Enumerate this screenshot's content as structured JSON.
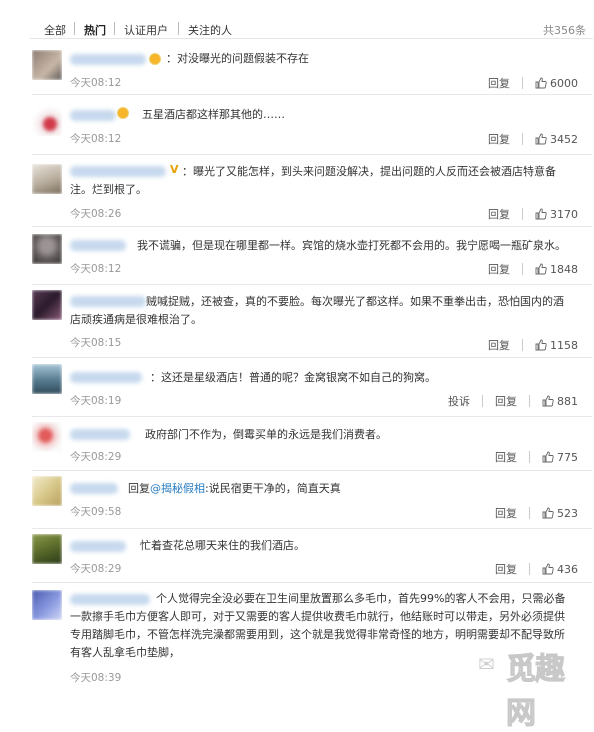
{
  "tabs": [
    {
      "label": "全部"
    },
    {
      "label": "热门"
    },
    {
      "label": "认证用户"
    },
    {
      "label": "关注的人"
    }
  ],
  "total_count": "共356条",
  "actions": {
    "reply": "回复",
    "report": "投诉"
  },
  "comments": [
    {
      "text": "：对没曝光的问题假装不存在",
      "time": "今天08:12",
      "likes": "6000"
    },
    {
      "text": "五星酒店都这样那其他的……",
      "time": "今天08:12",
      "likes": "3452"
    },
    {
      "text": "：曝光了又能怎样，到头来问题没解决，提出问题的人反而还会被酒店特意备注。烂到根了。",
      "time": "今天08:26",
      "likes": "3170"
    },
    {
      "text": "我不谎骗，但是现在哪里都一样。宾馆的烧水壶打死都不会用的。我宁愿喝一瓶矿泉水。",
      "time": "今天08:12",
      "likes": "1848"
    },
    {
      "text": "贼喊捉贼，还被查，真的不要脸。每次曝光了都这样。如果不重拳出击，恐怕国内的酒店顽疾通病是很难根治了。",
      "time": "今天08:15",
      "likes": "1158"
    },
    {
      "text": "：这还是星级酒店！普通的呢？金窝银窝不如自己的狗窝。",
      "time": "今天08:19",
      "likes": "881"
    },
    {
      "text": "政府部门不作为，倒霉买单的永远是我们消费者。",
      "time": "今天08:29",
      "likes": "775"
    },
    {
      "text_prefix": "回复",
      "text_link": "@揭秘假相",
      "text": ":说民宿更干净的，简直天真",
      "time": "今天09:58",
      "likes": "523"
    },
    {
      "text": "忙着查花总哪天来住的我们酒店。",
      "time": "今天08:29",
      "likes": "436"
    },
    {
      "text": "个人觉得完全没必要在卫生间里放置那么多毛巾，首先99%的客人不会用，只需必备一款擦手毛巾方便客人即可，对于又需要的客人提供收费毛巾就行，他结账时可以带走，另外必须提供专用踏脚毛巾，不管怎样洗完澡都需要用到，这个就是我觉得非常奇怪的地方，明明需要却不配导致所有客人乱拿毛巾垫脚，",
      "time": "今天08:39",
      "likes": ""
    }
  ],
  "watermark": {
    "text": "觅趣网"
  },
  "colors": {
    "link": "#2a7ec2",
    "badge": "#f7b529",
    "time": "#999999"
  }
}
